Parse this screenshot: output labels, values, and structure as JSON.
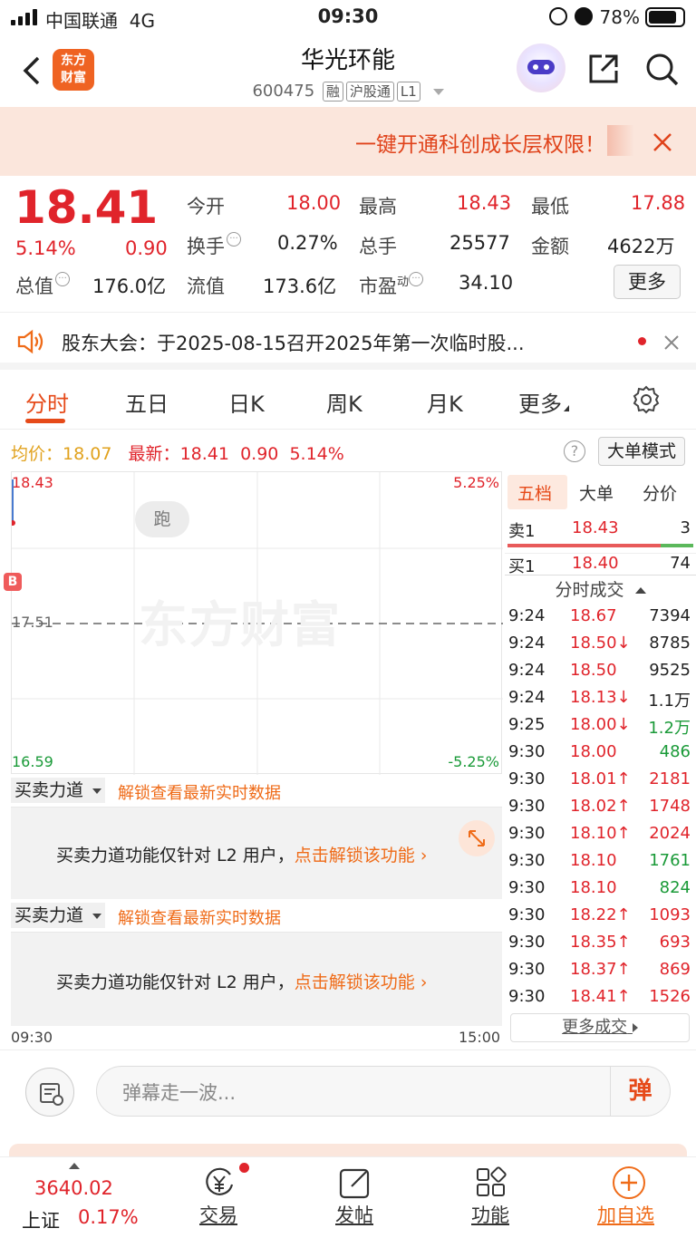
{
  "status": {
    "carrier": "中国联通",
    "network": "4G",
    "time": "09:30",
    "battery": "78%"
  },
  "header": {
    "logo": "东方财富",
    "title": "华光环能",
    "code": "600475",
    "tags": [
      "融",
      "沪股通",
      "L1"
    ]
  },
  "banner": {
    "text": "一键开通科创成长层权限！"
  },
  "quote": {
    "price": "18.41",
    "change_pct": "5.14%",
    "change": "0.90",
    "open_label": "今开",
    "open": "18.00",
    "high_label": "最高",
    "high": "18.43",
    "low_label": "最低",
    "low": "17.88",
    "turnover_label": "换手",
    "turnover": "0.27%",
    "volume_label": "总手",
    "volume": "25577",
    "amount_label": "金额",
    "amount": "4622万",
    "mktcap_label": "总值",
    "mktcap": "176.0亿",
    "float_label": "流值",
    "float": "173.6亿",
    "pe_label": "市盈",
    "pe_sup": "动",
    "pe": "34.10",
    "more_btn": "更多"
  },
  "notice": {
    "text": "股东大会：于2025-08-15召开2025年第一次临时股..."
  },
  "tabs": [
    "分时",
    "五日",
    "日K",
    "周K",
    "月K",
    "更多"
  ],
  "chart_info": {
    "avg_label": "均价：",
    "avg": "18.07",
    "last_label": "最新：",
    "last": "18.41",
    "chg": "0.90",
    "chg_pct": "5.14%",
    "mode_btn": "大单模式"
  },
  "chart_data": {
    "type": "line",
    "y_top": "18.43",
    "y_mid": "17.51",
    "y_bottom": "16.59",
    "pct_top": "5.25%",
    "pct_bottom": "-5.25%",
    "x_start": "09:30",
    "x_end": "15:00",
    "marker": "B",
    "bubble": "跑",
    "watermark": "东方财富"
  },
  "panel": {
    "tabs": [
      "五档",
      "大单",
      "分价"
    ],
    "sell1": {
      "label": "卖1",
      "price": "18.43",
      "vol": "3"
    },
    "buy1": {
      "label": "买1",
      "price": "18.40",
      "vol": "74"
    },
    "ticks_title": "分时成交",
    "ticks": [
      {
        "t": "9:24",
        "p": "18.67",
        "v": "7394",
        "pc": "red",
        "vc": "dark"
      },
      {
        "t": "9:24",
        "p": "18.50↓",
        "v": "8785",
        "pc": "red",
        "vc": "dark"
      },
      {
        "t": "9:24",
        "p": "18.50",
        "v": "9525",
        "pc": "red",
        "vc": "dark"
      },
      {
        "t": "9:24",
        "p": "18.13↓",
        "v": "1.1万",
        "pc": "red",
        "vc": "dark"
      },
      {
        "t": "9:25",
        "p": "18.00↓",
        "v": "1.2万",
        "pc": "red",
        "vc": "green"
      },
      {
        "t": "9:30",
        "p": "18.00",
        "v": "486",
        "pc": "red",
        "vc": "green"
      },
      {
        "t": "9:30",
        "p": "18.01↑",
        "v": "2181",
        "pc": "red",
        "vc": "red"
      },
      {
        "t": "9:30",
        "p": "18.02↑",
        "v": "1748",
        "pc": "red",
        "vc": "red"
      },
      {
        "t": "9:30",
        "p": "18.10↑",
        "v": "2024",
        "pc": "red",
        "vc": "red"
      },
      {
        "t": "9:30",
        "p": "18.10",
        "v": "1761",
        "pc": "red",
        "vc": "green"
      },
      {
        "t": "9:30",
        "p": "18.10",
        "v": "824",
        "pc": "red",
        "vc": "green"
      },
      {
        "t": "9:30",
        "p": "18.22↑",
        "v": "1093",
        "pc": "red",
        "vc": "red"
      },
      {
        "t": "9:30",
        "p": "18.35↑",
        "v": "693",
        "pc": "red",
        "vc": "red"
      },
      {
        "t": "9:30",
        "p": "18.37↑",
        "v": "869",
        "pc": "red",
        "vc": "red"
      },
      {
        "t": "9:30",
        "p": "18.41↑",
        "v": "1526",
        "pc": "red",
        "vc": "red"
      }
    ],
    "more_ticks": "更多成交"
  },
  "force": {
    "label": "买卖力道",
    "unlock": "解锁查看最新实时数据",
    "msg": "买卖力道功能仅针对 L2 用户，",
    "msg_link": "点击解锁该功能"
  },
  "comment": {
    "placeholder": "弹幕走一波...",
    "send": "弹"
  },
  "nav": {
    "index_value": "3640.02",
    "index_name": "上证",
    "index_pct": "0.17%",
    "items": [
      "交易",
      "发帖",
      "功能",
      "加自选"
    ]
  },
  "colors": {
    "up": "#e0242b",
    "down": "#1a9a38",
    "accent": "#ef6b18"
  }
}
